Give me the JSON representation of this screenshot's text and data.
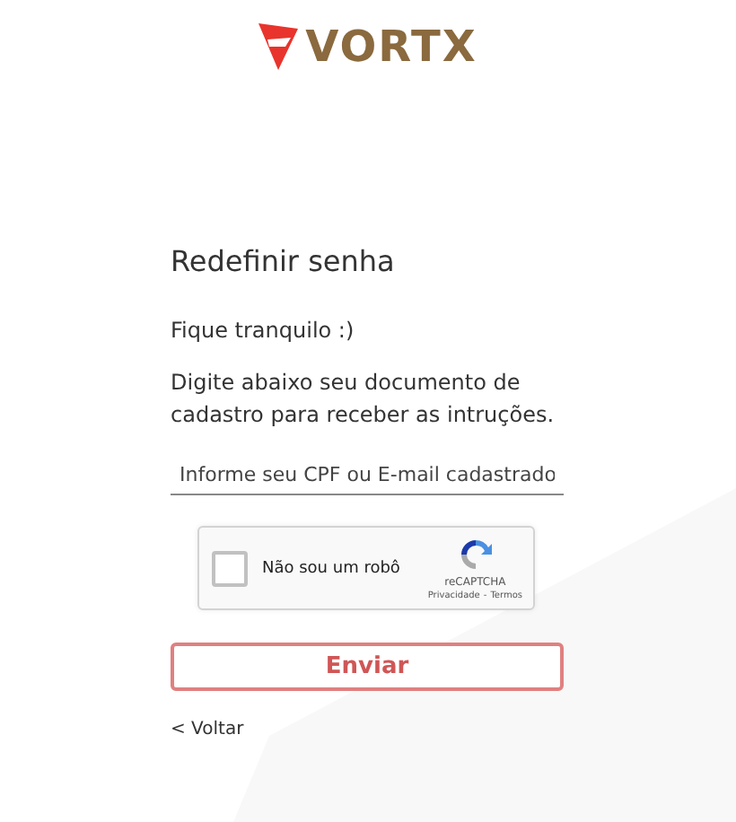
{
  "logo": {
    "text": "VORTX"
  },
  "title": "Redefinir senha",
  "subtitle": "Fique tranquilo :)",
  "instructions": "Digite abaixo seu documento de cadastro para receber as intruções.",
  "field": {
    "placeholder": "Informe seu CPF ou E-mail cadastrado"
  },
  "captcha": {
    "label": "Não sou um robô",
    "checked": false,
    "brand": "reCAPTCHA",
    "privacy": "Privacidade",
    "separator": "-",
    "terms": "Termos"
  },
  "submit": "Enviar",
  "back": "< Voltar"
}
